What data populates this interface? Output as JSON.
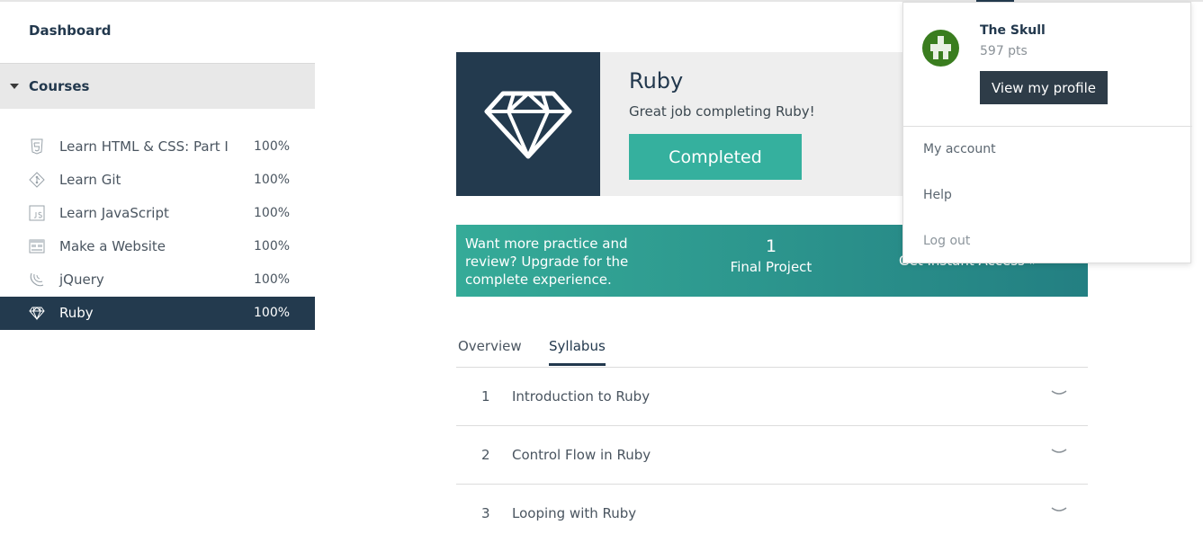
{
  "sidebar": {
    "dashboard_label": "Dashboard",
    "courses_label": "Courses",
    "courses": [
      {
        "name": "Learn HTML & CSS: Part I",
        "pct": "100%",
        "icon": "html5-icon"
      },
      {
        "name": "Learn Git",
        "pct": "100%",
        "icon": "git-icon"
      },
      {
        "name": "Learn JavaScript",
        "pct": "100%",
        "icon": "js-icon"
      },
      {
        "name": "Make a Website",
        "pct": "100%",
        "icon": "website-icon"
      },
      {
        "name": "jQuery",
        "pct": "100%",
        "icon": "jquery-icon"
      },
      {
        "name": "Ruby",
        "pct": "100%",
        "icon": "ruby-gem-icon"
      }
    ]
  },
  "hero": {
    "title": "Ruby",
    "subtitle": "Great job completing Ruby!",
    "status_button": "Completed",
    "icon": "diamond-icon"
  },
  "promo": {
    "text": "Want more practice and review? Upgrade for the complete experience.",
    "count": "1",
    "count_label": "Final Project",
    "cta": "Get Instant Access »"
  },
  "tabs": [
    "Overview",
    "Syllabus"
  ],
  "syllabus": [
    {
      "num": "1",
      "title": "Introduction to Ruby"
    },
    {
      "num": "2",
      "title": "Control Flow in Ruby"
    },
    {
      "num": "3",
      "title": "Looping with Ruby"
    }
  ],
  "user_menu": {
    "username": "The Skull",
    "points": "597 pts",
    "profile_button": "View my profile",
    "items": [
      "My account",
      "Help",
      "Log out"
    ]
  },
  "colors": {
    "navy": "#233a4e",
    "teal": "#35b09e",
    "avatar_green": "#3a7d1f"
  }
}
